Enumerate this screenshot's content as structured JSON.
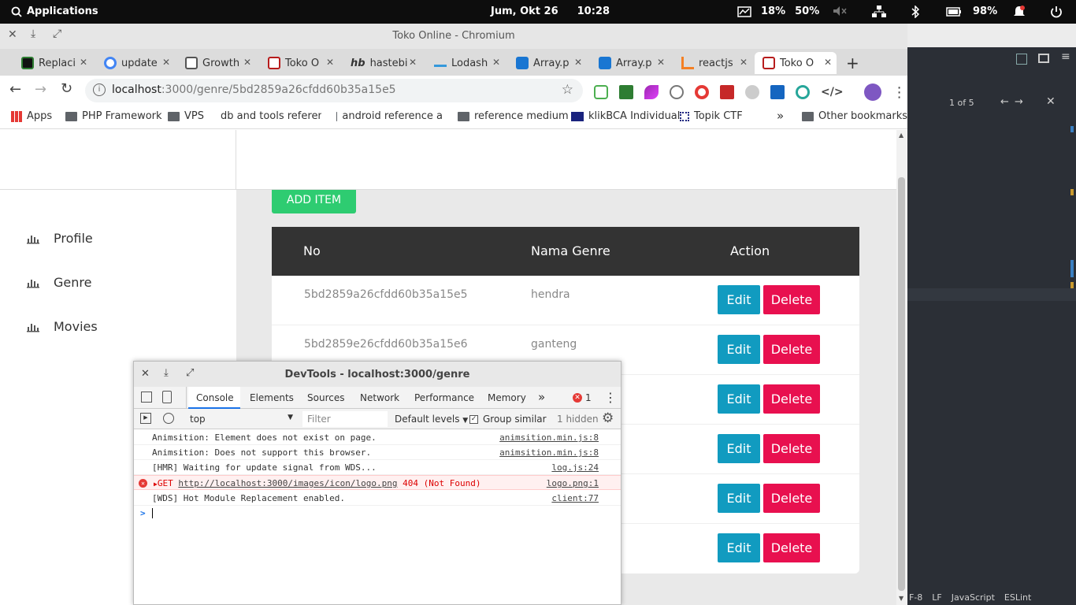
{
  "system": {
    "applications": "Applications",
    "datetime": "Jum, Okt 26",
    "time": "10:28",
    "cpu": "18%",
    "mem": "50%",
    "battery": "98%"
  },
  "window": {
    "title": "Toko Online - Chromium"
  },
  "tabs": [
    {
      "label": "Replaci",
      "color": "#2e7d32"
    },
    {
      "label": "update",
      "color": "#4285f4"
    },
    {
      "label": "Growth",
      "color": "#555"
    },
    {
      "label": "Toko O",
      "color": "#b71c1c"
    },
    {
      "label": "hastebi",
      "color": "#333"
    },
    {
      "label": "Lodash",
      "color": "#3498db"
    },
    {
      "label": "Array.p",
      "color": "#1976d2"
    },
    {
      "label": "Array.p",
      "color": "#1976d2"
    },
    {
      "label": "reactjs",
      "color": "#f48024"
    },
    {
      "label": "Toko O",
      "color": "#b71c1c"
    }
  ],
  "new_tab": "+",
  "url": {
    "host": "localhost",
    "rest": ":3000/genre/5bd2859a26cfdd60b35a15e5"
  },
  "bookmarks": [
    {
      "label": "Apps"
    },
    {
      "label": "PHP Framework"
    },
    {
      "label": "VPS"
    },
    {
      "label": "db and tools referen"
    },
    {
      "label": "android reference a"
    },
    {
      "label": "reference medium"
    },
    {
      "label": "klikBCA Individual"
    },
    {
      "label": "Topik CTF"
    },
    {
      "label": "Other bookmarks"
    }
  ],
  "bookmarks_more": "»",
  "sidebar": {
    "items": [
      {
        "label": "Profile"
      },
      {
        "label": "Genre"
      },
      {
        "label": "Movies"
      }
    ]
  },
  "page": {
    "add_item": "ADD ITEM",
    "headers": {
      "no": "No",
      "name": "Nama Genre",
      "action": "Action"
    },
    "edit_label": "Edit",
    "delete_label": "Delete",
    "rows": [
      {
        "id": "5bd2859a26cfdd60b35a15e5",
        "name": "hendra"
      },
      {
        "id": "5bd2859e26cfdd60b35a15e6",
        "name": "ganteng"
      },
      {
        "id": "",
        "name": ""
      },
      {
        "id": "",
        "name": ""
      },
      {
        "id": "",
        "name": ""
      },
      {
        "id": "",
        "name": ""
      }
    ]
  },
  "devtools": {
    "title": "DevTools - localhost:3000/genre",
    "tabs": [
      "Console",
      "Elements",
      "Sources",
      "Network",
      "Performance",
      "Memory"
    ],
    "more": "»",
    "error_count": "1",
    "context": "top",
    "filter_placeholder": "Filter",
    "levels": "Default levels",
    "group_similar": "Group similar",
    "hidden": "1 hidden",
    "logs": [
      {
        "msg": "Animsition: Element does not exist on page.",
        "src": "animsition.min.js:8"
      },
      {
        "msg": "Animsition: Does not support this browser.",
        "src": "animsition.min.js:8"
      },
      {
        "msg": "[HMR] Waiting for update signal from WDS...",
        "src": "log.js:24"
      },
      {
        "msg_prefix": "GET ",
        "msg_link": "http://localhost:3000/images/icon/logo.png",
        "msg_suffix": " 404 (Not Found)",
        "src": "logo.png:1"
      },
      {
        "msg": "[WDS] Hot Module Replacement enabled.",
        "src": "client:77"
      }
    ],
    "prompt": ">"
  },
  "editor": {
    "find_count": "1 of 5",
    "status": [
      "F-8",
      "LF",
      "JavaScript",
      "ESLint"
    ]
  },
  "colors": {
    "add_item": "#2ecc71",
    "edit": "#119bc0",
    "delete": "#e8104f",
    "table_header": "#333333"
  }
}
